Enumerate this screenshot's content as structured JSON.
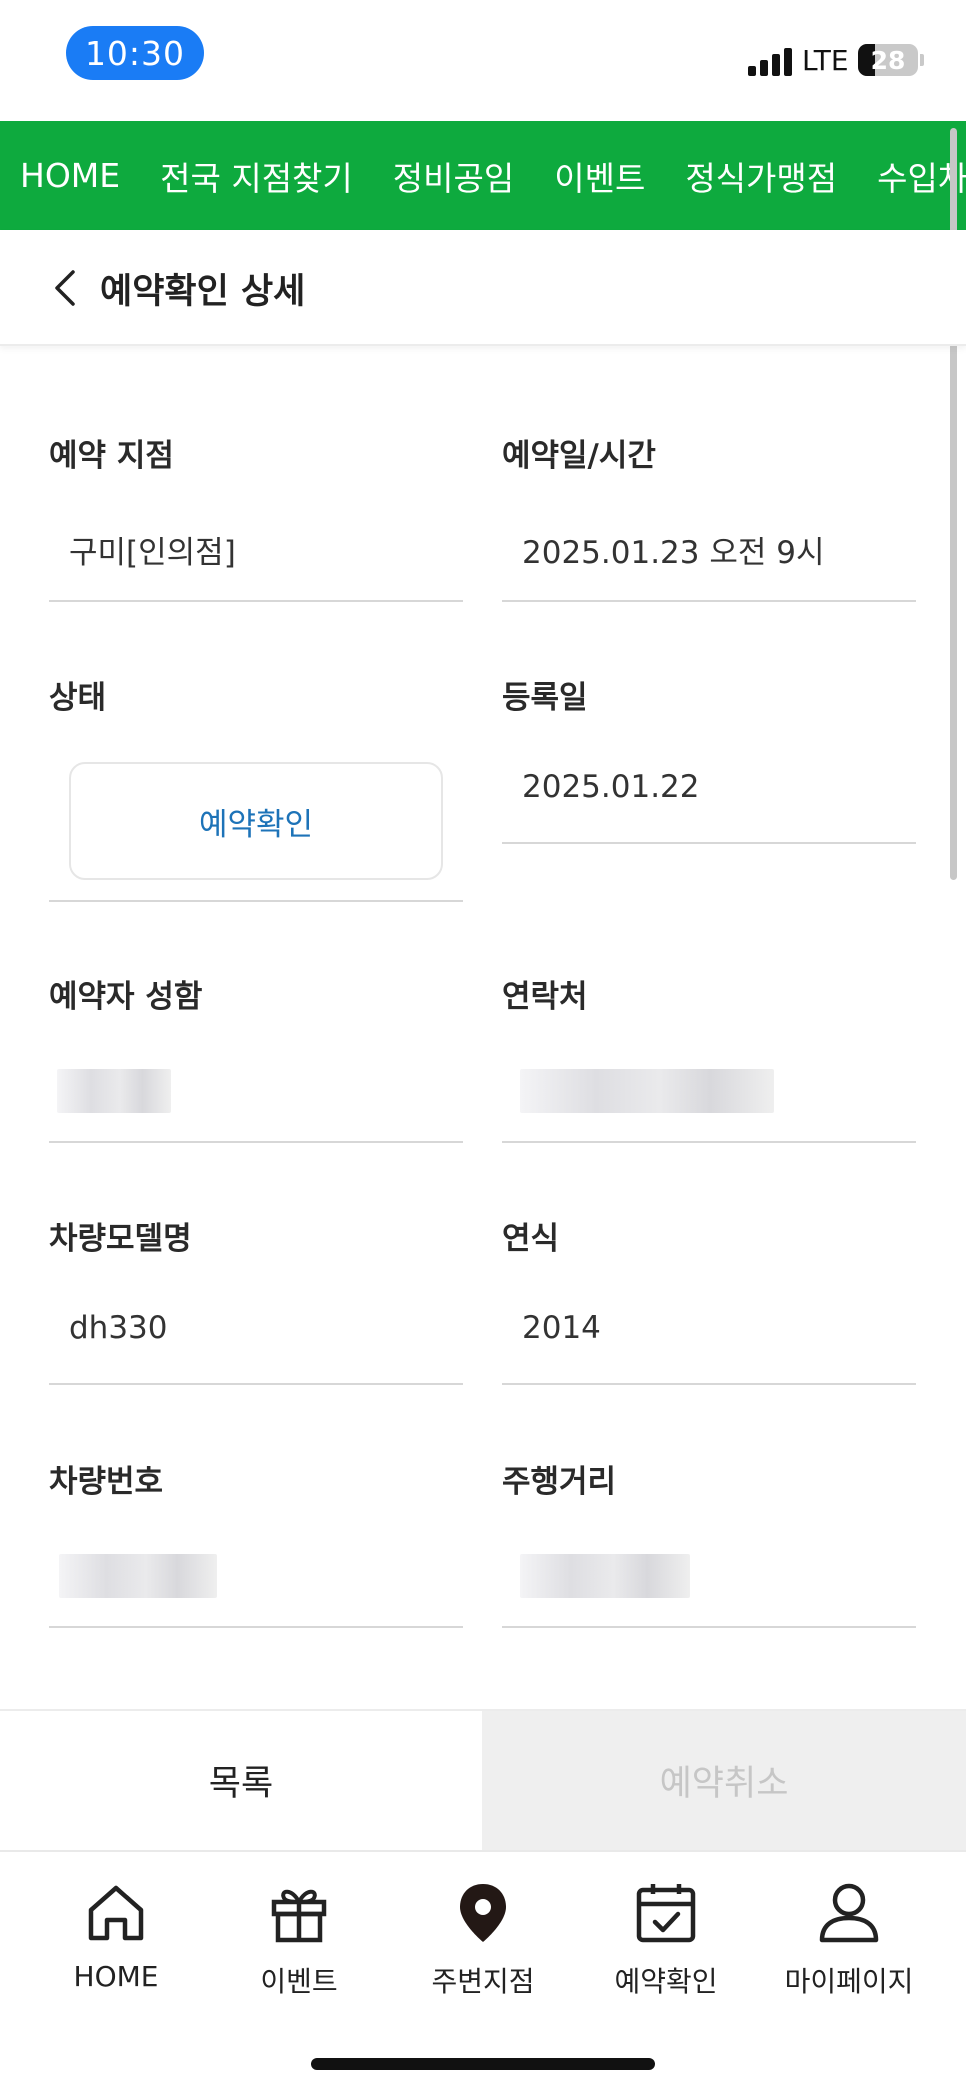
{
  "status_bar": {
    "time": "10:30",
    "network": "LTE",
    "battery": "28",
    "battery_level_percent": 28
  },
  "top_nav": {
    "items": [
      "HOME",
      "전국 지점찾기",
      "정비공임",
      "이벤트",
      "정식가맹점",
      "수입차전"
    ]
  },
  "header": {
    "back_icon": "chevron-left-icon",
    "title": "예약확인 상세"
  },
  "form": {
    "branch": {
      "label": "예약 지점",
      "value": "구미[인의점]"
    },
    "datetime": {
      "label": "예약일/시간",
      "value": "2025.01.23 오전 9시"
    },
    "status": {
      "label": "상태",
      "value": "예약확인",
      "color": "#1d73b8"
    },
    "registered": {
      "label": "등록일",
      "value": "2025.01.22"
    },
    "name": {
      "label": "예약자 성함"
    },
    "phone": {
      "label": "연락처"
    },
    "model": {
      "label": "차량모델명",
      "value": "dh330"
    },
    "year": {
      "label": "연식",
      "value": "2014"
    },
    "plate": {
      "label": "차량번호"
    },
    "mileage": {
      "label": "주행거리"
    }
  },
  "actions": {
    "list_label": "목록",
    "cancel_label": "예약취소"
  },
  "tab_bar": {
    "items": [
      {
        "label": "HOME",
        "icon": "home-icon"
      },
      {
        "label": "이벤트",
        "icon": "gift-icon"
      },
      {
        "label": "주변지점",
        "icon": "location-pin-icon"
      },
      {
        "label": "예약확인",
        "icon": "calendar-check-icon"
      },
      {
        "label": "마이페이지",
        "icon": "user-icon"
      }
    ]
  },
  "colors": {
    "brand_green": "#0eaa3e",
    "time_pill_blue": "#1a7cf5",
    "status_blue": "#1d73b8",
    "disabled_text": "#c6c6c6"
  }
}
